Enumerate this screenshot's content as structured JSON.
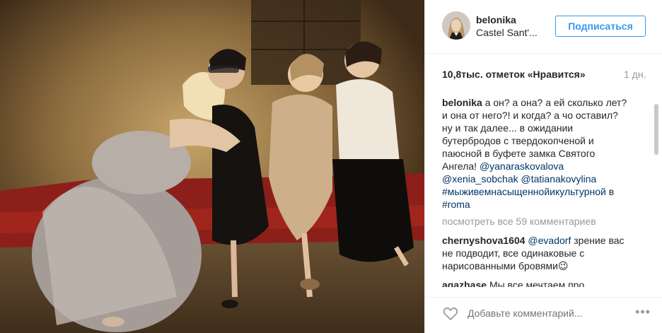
{
  "post": {
    "image_alt": "photo",
    "header": {
      "username": "belonika",
      "location": "Castel Sant'...",
      "follow_label": "Подписаться"
    },
    "likes_text": "10,8тыс. отметок «Нравится»",
    "time_ago": "1 дн.",
    "caption": {
      "username": "belonika",
      "lines": [
        "а он? а она? а ей сколько лет?",
        "и она от него?! и когда? а чо оставил?",
        "ну и так далее... в ожидании",
        "бутербродов с твердокопченой и",
        "паюсной в буфете замка Святого",
        "Ангела!"
      ],
      "mention_1": "@yanaraskovalova",
      "mention_2": "@xenia_sobchak",
      "mention_3": "@tatianakovylina",
      "hashtag_1": "#мыживемнасыщеннойикультурной",
      "in_word": "в",
      "hashtag_2": "#roma"
    },
    "view_all_comments": "посмотреть все 59 комментариев",
    "comments": [
      {
        "username": "chernyshova1604",
        "mention": "@evadorf",
        "text_1": "зрение вас",
        "text_2": "не подводит, все одинаковые с",
        "text_3": "нарисованными бровями",
        "emoji": "😉"
      },
      {
        "username": "agazhase",
        "text_1": "Мы все мечтаем про"
      }
    ],
    "footer": {
      "add_comment_placeholder": "Добавьте комментарий...",
      "more_icon": "•••"
    }
  },
  "colors": {
    "accent": "#3897f0",
    "link": "#003569",
    "muted": "#999999",
    "text": "#262626"
  }
}
